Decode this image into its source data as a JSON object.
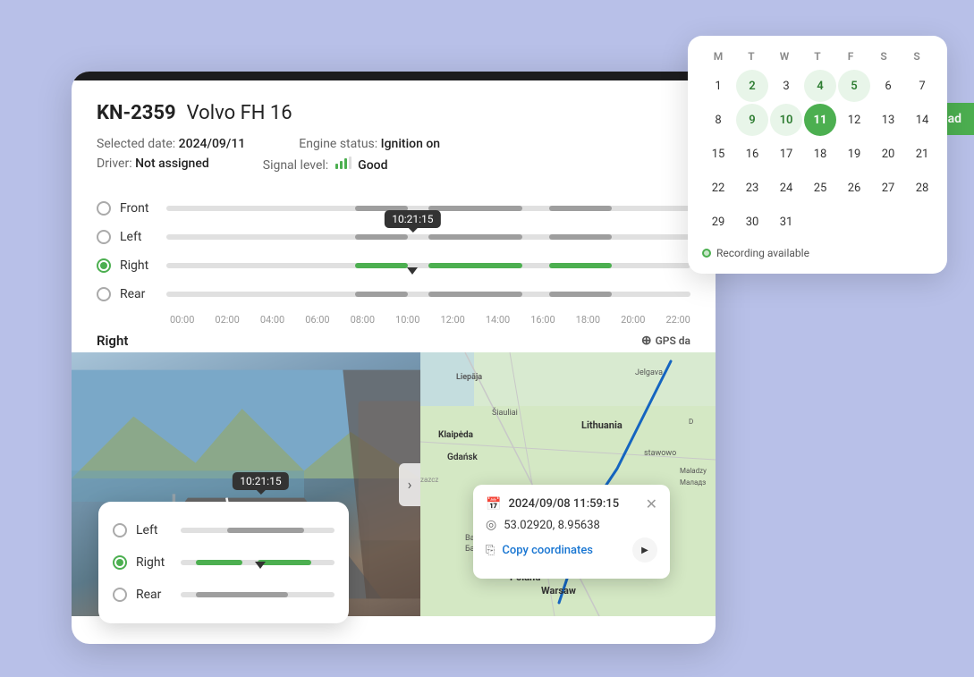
{
  "vehicle": {
    "id": "KN-2359",
    "name": "Volvo FH 16",
    "selected_date_label": "Selected date:",
    "selected_date_value": "2024/09/11",
    "driver_label": "Driver:",
    "driver_value": "Not assigned",
    "engine_label": "Engine status:",
    "engine_value": "Ignition on",
    "signal_label": "Signal level:",
    "signal_value": "Good"
  },
  "cameras": [
    {
      "id": "front",
      "label": "Front",
      "active": false
    },
    {
      "id": "left",
      "label": "Left",
      "active": false
    },
    {
      "id": "right",
      "label": "Right",
      "active": true
    },
    {
      "id": "rear",
      "label": "Rear",
      "active": false
    }
  ],
  "timeline": {
    "current_time": "10:21:15",
    "time_labels": [
      "00:00",
      "02:00",
      "04:00",
      "06:00",
      "08:00",
      "10:00",
      "12:00",
      "14:00",
      "16:00",
      "18:00",
      "20:00",
      "22:00"
    ]
  },
  "current_camera_label": "Right",
  "gps_label": "GPS da",
  "calendar": {
    "days_header": [
      "M",
      "T",
      "W",
      "T",
      "F",
      "S",
      "S"
    ],
    "rows": [
      [
        {
          "n": 1,
          "state": ""
        },
        {
          "n": 2,
          "state": "has-data"
        },
        {
          "n": 3,
          "state": ""
        },
        {
          "n": 4,
          "state": "has-data"
        },
        {
          "n": 5,
          "state": "has-data"
        },
        {
          "n": 6,
          "state": ""
        },
        {
          "n": 7,
          "state": ""
        }
      ],
      [
        {
          "n": 8,
          "state": ""
        },
        {
          "n": 9,
          "state": "has-data"
        },
        {
          "n": 10,
          "state": "has-data"
        },
        {
          "n": 11,
          "state": "selected"
        },
        {
          "n": 12,
          "state": ""
        },
        {
          "n": 13,
          "state": ""
        },
        {
          "n": 14,
          "state": ""
        }
      ],
      [
        {
          "n": 15,
          "state": ""
        },
        {
          "n": 16,
          "state": ""
        },
        {
          "n": 17,
          "state": ""
        },
        {
          "n": 18,
          "state": ""
        },
        {
          "n": 19,
          "state": ""
        },
        {
          "n": 20,
          "state": ""
        },
        {
          "n": 21,
          "state": ""
        }
      ],
      [
        {
          "n": 22,
          "state": ""
        },
        {
          "n": 23,
          "state": ""
        },
        {
          "n": 24,
          "state": ""
        },
        {
          "n": 25,
          "state": ""
        },
        {
          "n": 26,
          "state": ""
        },
        {
          "n": 27,
          "state": ""
        },
        {
          "n": 28,
          "state": ""
        }
      ],
      [
        {
          "n": 29,
          "state": ""
        },
        {
          "n": 30,
          "state": ""
        },
        {
          "n": 31,
          "state": ""
        },
        null,
        null,
        null,
        null
      ]
    ],
    "legend": "Recording available",
    "download_btn": "nload"
  },
  "mini_panel": {
    "cameras": [
      {
        "label": "Left",
        "active": false
      },
      {
        "label": "Right",
        "active": true
      },
      {
        "label": "Rear",
        "active": false
      }
    ],
    "time_tooltip": "10:21:15"
  },
  "gps_popup": {
    "datetime": "2024/09/08 11:59:15",
    "coordinates": "53.02920, 8.95638",
    "copy_label": "Copy coordinates"
  }
}
